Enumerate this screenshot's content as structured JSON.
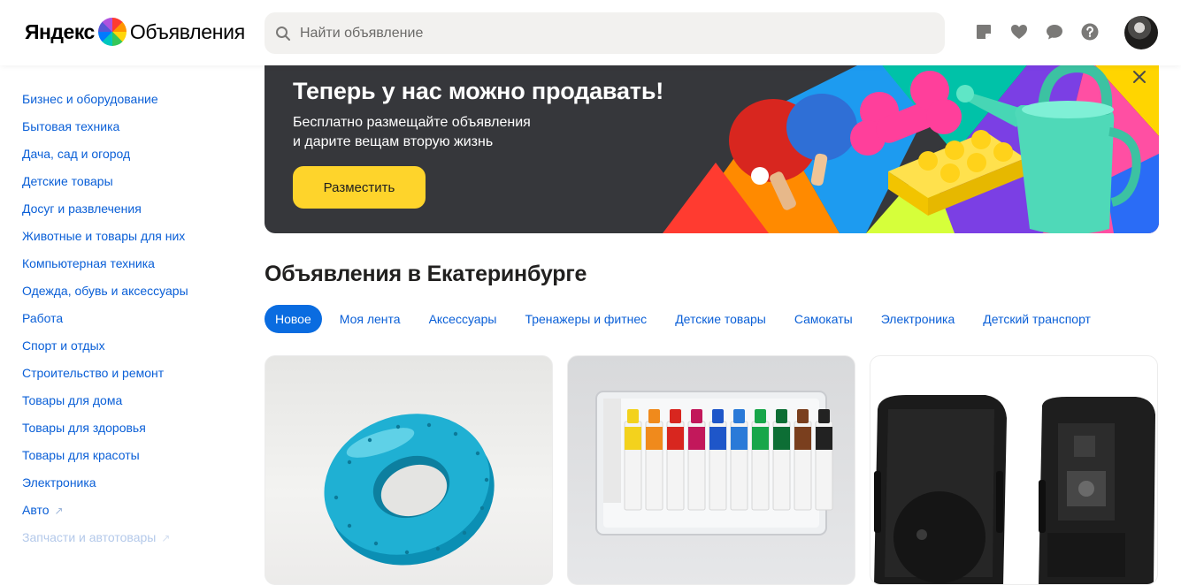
{
  "header": {
    "logo_brand": "Яндекс",
    "logo_service": "Объявления",
    "search_placeholder": "Найти объявление",
    "icons": [
      "notes-icon",
      "heart-icon",
      "chat-icon",
      "help-icon"
    ]
  },
  "sidebar": {
    "categories": [
      "Бизнес и оборудование",
      "Бытовая техника",
      "Дача, сад и огород",
      "Детские товары",
      "Досуг и развлечения",
      "Животные и товары для них",
      "Компьютерная техника",
      "Одежда, обувь и аксессуары",
      "Работа",
      "Спорт и отдых",
      "Строительство и ремонт",
      "Товары для дома",
      "Товары для здоровья",
      "Товары для красоты",
      "Электроника",
      "Авто",
      "Запчасти и автотовары"
    ]
  },
  "banner": {
    "title": "Теперь у нас можно продавать!",
    "subtitle_line1": "Бесплатно размещайте объявления",
    "subtitle_line2": "и дарите вещам вторую жизнь",
    "button_label": "Разместить"
  },
  "section": {
    "title": "Объявления в Екатеринбурге"
  },
  "tabs": [
    "Новое",
    "Моя лента",
    "Аксессуары",
    "Тренажеры и фитнес",
    "Детские товары",
    "Самокаты",
    "Электроника",
    "Детский транспорт"
  ],
  "active_tab": "Новое",
  "colors": {
    "link": "#0a5fd7",
    "active_tab": "#0a6ce0",
    "button": "#fed42b",
    "banner_bg": "#36373b"
  }
}
